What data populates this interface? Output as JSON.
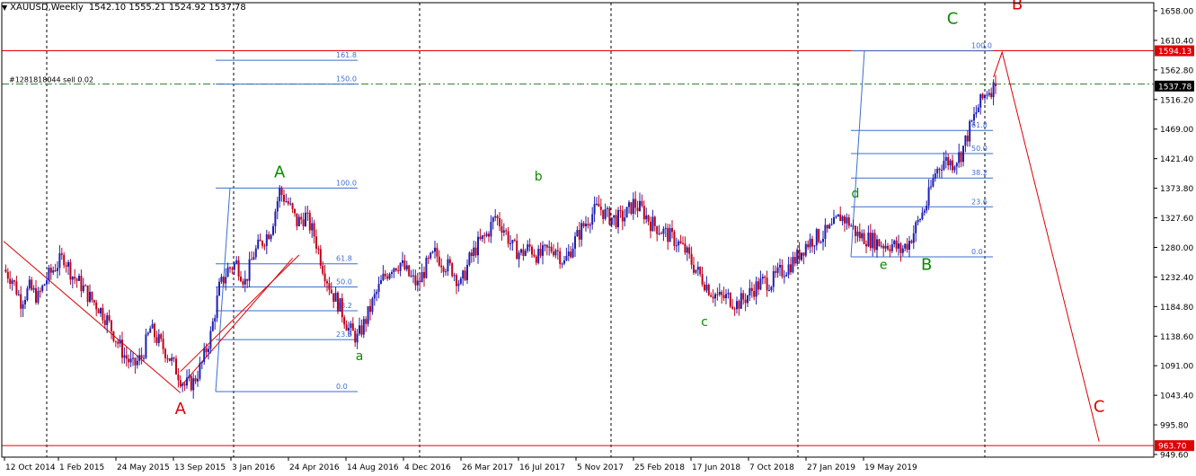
{
  "header": {
    "symbol": "XAUUSD,Weekly",
    "ohlc": "1542.10 1555.21 1524.92 1537.78"
  },
  "order_label": "#1281818044 sell 0.02",
  "colors": {
    "up_candle": "#1f1fb0",
    "down_candle": "#c0001a",
    "wave_green": "#0b8a00",
    "wave_red": "#dd0000",
    "fib_line": "#3a6fd0",
    "hline_red": "#e00000",
    "order_line": "#2a7d2a"
  },
  "chart_data": {
    "type": "candlestick",
    "price_axis": {
      "min": 949.6,
      "max": 1658.0,
      "ticks": [
        "1658.00",
        "1610.40",
        "1562.80",
        "1516.20",
        "1469.00",
        "1421.40",
        "1373.80",
        "1327.60",
        "1280.00",
        "1232.40",
        "1184.80",
        "1138.60",
        "1091.00",
        "1043.40",
        "995.80",
        "949.60"
      ]
    },
    "time_axis": {
      "labels": [
        "12 Oct 2014",
        "1 Feb 2015",
        "24 May 2015",
        "13 Sep 2015",
        "3 Jan 2016",
        "24 Apr 2016",
        "14 Aug 2016",
        "4 Dec 2016",
        "26 Mar 2017",
        "16 Jul 2017",
        "5 Nov 2017",
        "25 Feb 2018",
        "17 Jun 2018",
        "7 Oct 2018",
        "27 Jan 2019",
        "19 May 2019"
      ]
    },
    "price_tags": [
      {
        "value": "1594.13",
        "kind": "level"
      },
      {
        "value": "1537.78",
        "kind": "current"
      },
      {
        "value": "963.70",
        "kind": "level"
      }
    ],
    "horizontal_levels": [
      1594.13,
      963.7
    ],
    "order_line_price": 1541.0,
    "weekly_close_path": [
      [
        0,
        1245
      ],
      [
        4,
        1230
      ],
      [
        8,
        1195
      ],
      [
        12,
        1215
      ],
      [
        16,
        1200
      ],
      [
        20,
        1230
      ],
      [
        24,
        1250
      ],
      [
        28,
        1265
      ],
      [
        32,
        1235
      ],
      [
        36,
        1220
      ],
      [
        40,
        1200
      ],
      [
        44,
        1185
      ],
      [
        48,
        1165
      ],
      [
        52,
        1135
      ],
      [
        56,
        1108
      ],
      [
        60,
        1090
      ],
      [
        64,
        1105
      ],
      [
        68,
        1150
      ],
      [
        72,
        1130
      ],
      [
        76,
        1110
      ],
      [
        80,
        1085
      ],
      [
        84,
        1060
      ],
      [
        88,
        1065
      ],
      [
        92,
        1095
      ],
      [
        96,
        1140
      ],
      [
        100,
        1215
      ],
      [
        104,
        1245
      ],
      [
        108,
        1255
      ],
      [
        112,
        1225
      ],
      [
        116,
        1270
      ],
      [
        120,
        1290
      ],
      [
        124,
        1310
      ],
      [
        128,
        1370
      ],
      [
        132,
        1350
      ],
      [
        136,
        1320
      ],
      [
        140,
        1330
      ],
      [
        144,
        1300
      ],
      [
        148,
        1250
      ],
      [
        152,
        1210
      ],
      [
        156,
        1185
      ],
      [
        160,
        1150
      ],
      [
        164,
        1135
      ],
      [
        168,
        1165
      ],
      [
        172,
        1200
      ],
      [
        176,
        1230
      ],
      [
        180,
        1250
      ],
      [
        184,
        1255
      ],
      [
        188,
        1235
      ],
      [
        192,
        1220
      ],
      [
        196,
        1250
      ],
      [
        200,
        1270
      ],
      [
        204,
        1255
      ],
      [
        208,
        1245
      ],
      [
        212,
        1220
      ],
      [
        216,
        1260
      ],
      [
        220,
        1285
      ],
      [
        224,
        1300
      ],
      [
        228,
        1330
      ],
      [
        232,
        1310
      ],
      [
        236,
        1280
      ],
      [
        240,
        1270
      ],
      [
        244,
        1280
      ],
      [
        248,
        1265
      ],
      [
        252,
        1275
      ],
      [
        256,
        1280
      ],
      [
        260,
        1255
      ],
      [
        264,
        1285
      ],
      [
        268,
        1310
      ],
      [
        272,
        1330
      ],
      [
        276,
        1345
      ],
      [
        280,
        1330
      ],
      [
        284,
        1325
      ],
      [
        288,
        1330
      ],
      [
        292,
        1350
      ],
      [
        296,
        1340
      ],
      [
        300,
        1320
      ],
      [
        304,
        1310
      ],
      [
        308,
        1300
      ],
      [
        312,
        1290
      ],
      [
        316,
        1275
      ],
      [
        320,
        1250
      ],
      [
        324,
        1230
      ],
      [
        328,
        1210
      ],
      [
        332,
        1200
      ],
      [
        336,
        1200
      ],
      [
        340,
        1190
      ],
      [
        344,
        1200
      ],
      [
        348,
        1215
      ],
      [
        352,
        1225
      ],
      [
        356,
        1225
      ],
      [
        360,
        1240
      ],
      [
        364,
        1250
      ],
      [
        368,
        1265
      ],
      [
        372,
        1285
      ],
      [
        376,
        1295
      ],
      [
        380,
        1300
      ],
      [
        384,
        1310
      ],
      [
        388,
        1330
      ],
      [
        392,
        1320
      ],
      [
        396,
        1300
      ],
      [
        400,
        1295
      ],
      [
        404,
        1290
      ],
      [
        408,
        1285
      ],
      [
        412,
        1285
      ],
      [
        416,
        1275
      ],
      [
        420,
        1290
      ],
      [
        424,
        1320
      ],
      [
        428,
        1350
      ],
      [
        432,
        1400
      ],
      [
        436,
        1420
      ],
      [
        440,
        1415
      ],
      [
        444,
        1430
      ],
      [
        448,
        1470
      ],
      [
        452,
        1505
      ],
      [
        456,
        1530
      ],
      [
        460,
        1537.78
      ]
    ],
    "wave_labels": [
      {
        "text": "A",
        "color": "red",
        "price": 1014,
        "week": 82
      },
      {
        "text": "A",
        "color": "green",
        "price": 1392,
        "week": 128
      },
      {
        "text": "a",
        "color": "green",
        "price": 1100,
        "week": 165
      },
      {
        "text": "b",
        "color": "green",
        "price": 1387,
        "week": 248
      },
      {
        "text": "c",
        "color": "green",
        "price": 1155,
        "week": 325
      },
      {
        "text": "d",
        "color": "green",
        "price": 1360,
        "week": 395
      },
      {
        "text": "e",
        "color": "green",
        "price": 1246,
        "week": 408
      },
      {
        "text": "B",
        "color": "green",
        "price": 1244,
        "week": 428
      },
      {
        "text": "C",
        "color": "green",
        "price": 1637,
        "week": 440
      },
      {
        "text": "B",
        "color": "red",
        "price": 1660,
        "week": 470
      },
      {
        "text": "C",
        "color": "red",
        "price": 1018,
        "week": 508
      }
    ],
    "fibonacci_sets": [
      {
        "levels": [
          {
            "label": "161.8",
            "price": 1579
          },
          {
            "label": "150.0",
            "price": 1541
          },
          {
            "label": "100.0",
            "price": 1375
          },
          {
            "label": "61.8",
            "price": 1254
          },
          {
            "label": "50.0",
            "price": 1217
          },
          {
            "label": "38.2",
            "price": 1179
          },
          {
            "label": "23.6",
            "price": 1133
          },
          {
            "label": "0.0",
            "price": 1050
          }
        ]
      },
      {
        "levels": [
          {
            "label": "100.0",
            "price": 1594
          },
          {
            "label": "61.8",
            "price": 1467
          },
          {
            "label": "50.0",
            "price": 1430
          },
          {
            "label": "38.2",
            "price": 1391
          },
          {
            "label": "23.6",
            "price": 1345
          },
          {
            "label": "0.0",
            "price": 1265
          }
        ]
      }
    ],
    "projection_path": [
      [
        459,
        1552
      ],
      [
        463,
        1592
      ],
      [
        508,
        970
      ]
    ],
    "trendlines": [
      {
        "from": [
          0,
          1290
        ],
        "to": [
          82,
          1048
        ]
      },
      {
        "from": [
          82,
          1058
        ],
        "to": [
          134,
          1263
        ]
      },
      {
        "from": [
          82,
          1082
        ],
        "to": [
          137,
          1268
        ]
      }
    ]
  }
}
